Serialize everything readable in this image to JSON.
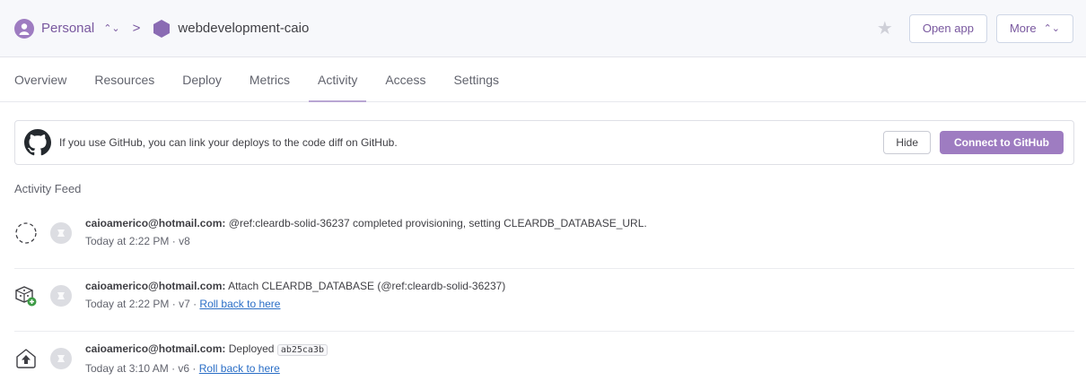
{
  "breadcrumb": {
    "account": "Personal",
    "separator": ">",
    "app_name": "webdevelopment-caio"
  },
  "header": {
    "open_app_label": "Open app",
    "more_label": "More"
  },
  "tabs": [
    {
      "label": "Overview"
    },
    {
      "label": "Resources"
    },
    {
      "label": "Deploy"
    },
    {
      "label": "Metrics"
    },
    {
      "label": "Activity",
      "active": true
    },
    {
      "label": "Access"
    },
    {
      "label": "Settings"
    }
  ],
  "banner": {
    "text": "If you use GitHub, you can link your deploys to the code diff on GitHub.",
    "hide_label": "Hide",
    "connect_label": "Connect to GitHub"
  },
  "feed": {
    "title": "Activity Feed",
    "items": [
      {
        "icon": "provisioning-dashed-circle-icon",
        "user": "caioamerico@hotmail.com:",
        "message": "@ref:cleardb-solid-36237 completed provisioning, setting CLEARDB_DATABASE_URL.",
        "time": "Today at 2:22 PM",
        "version": "v8"
      },
      {
        "icon": "addon-attach-icon",
        "user": "caioamerico@hotmail.com:",
        "message": "Attach CLEARDB_DATABASE (@ref:cleardb-solid-36237)",
        "time": "Today at 2:22 PM",
        "version": "v7",
        "rollback_label": "Roll back to here"
      },
      {
        "icon": "deploy-arrow-up-icon",
        "user": "caioamerico@hotmail.com:",
        "message": "Deployed",
        "commit": "ab25ca3b",
        "time": "Today at 3:10 AM",
        "version": "v6",
        "rollback_label": "Roll back to here"
      }
    ]
  },
  "colors": {
    "accent": "#79589f",
    "primary_button": "#9e7cc1",
    "link": "#2a6ec6"
  }
}
